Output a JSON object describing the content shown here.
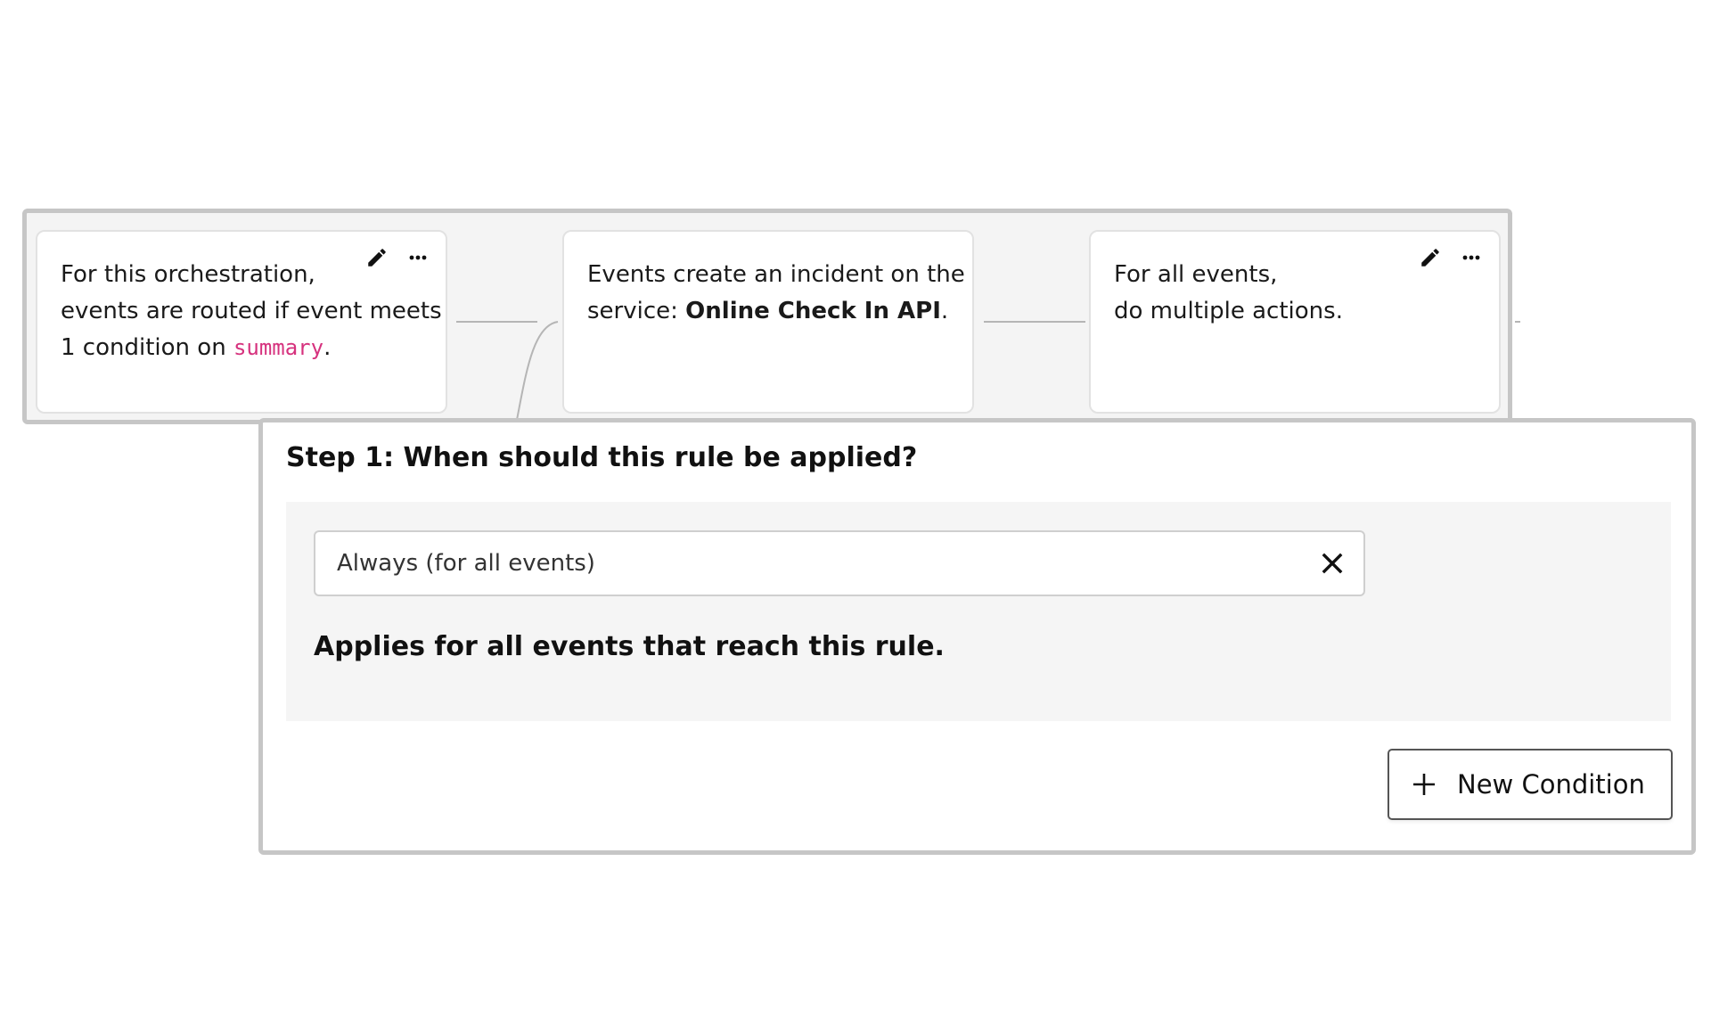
{
  "orchestration": {
    "cards": [
      {
        "lines": [
          "For this orchestration,",
          "events are routed if event meets",
          "1 condition on "
        ],
        "field": "summary",
        "suffix": ".",
        "has_actions": true
      },
      {
        "line1": "Events create an incident on the",
        "line2_prefix": "service: ",
        "service_name": "Online Check In API",
        "suffix": ".",
        "has_actions": false
      },
      {
        "lines": [
          "For all events,",
          "do multiple actions."
        ],
        "has_actions": true
      }
    ],
    "icons": {
      "edit": "pencil-icon",
      "more": "ellipsis-icon"
    }
  },
  "step": {
    "title": "Step 1: When should this rule be applied?",
    "condition_value": "Always (for all events)",
    "condition_description": "Applies for all events that reach this rule.",
    "new_condition_label": "New Condition"
  },
  "colors": {
    "panel_border": "#c6c6c6",
    "panel_bg": "#f4f4f4",
    "field_accent": "#d6327e",
    "connector": "#b5b5b5"
  }
}
